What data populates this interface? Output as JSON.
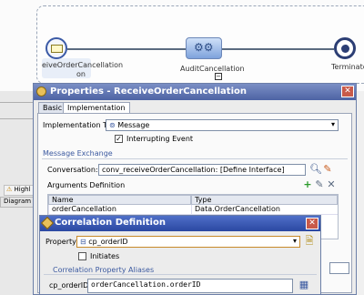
{
  "diagram": {
    "start_label": "eiveOrderCancellation",
    "start_sublabel": "on",
    "activity_label": "AuditCancellation",
    "end_label": "Terminate"
  },
  "background_tabs": {
    "warn_label": "Highl",
    "diagram_label": "Diagram"
  },
  "properties_dialog": {
    "title": "Properties - ReceiveOrderCancellation",
    "close_glyph": "✕",
    "tabs": [
      "Basic",
      "Implementation"
    ],
    "implementation_type_label": "Implementation Type:",
    "implementation_type_value": "Message",
    "interrupting_label": "Interrupting Event",
    "message_exchange_heading": "Message Exchange",
    "conversation_label": "Conversation:",
    "conversation_value": "conv_receiveOrderCancellation: [Define Interface]",
    "arguments_heading": "Arguments Definition",
    "columns": [
      "Name",
      "Type"
    ],
    "rows": [
      {
        "name": "orderCancellation",
        "type": "Data.OrderCancellation"
      }
    ]
  },
  "correlation_dialog": {
    "title": "Correlation Definition",
    "close_glyph": "✕",
    "property_label": "Property:",
    "property_value": "cp_orderID",
    "initiates_label": "Initiates",
    "aliases_heading": "Correlation Property Aliases",
    "alias_label": "cp_orderID:",
    "alias_value": "orderCancellation.orderID"
  },
  "colors": {
    "title_bar": "#4d63a4",
    "accent": "#3c5aa0",
    "close": "#c85a4a"
  }
}
